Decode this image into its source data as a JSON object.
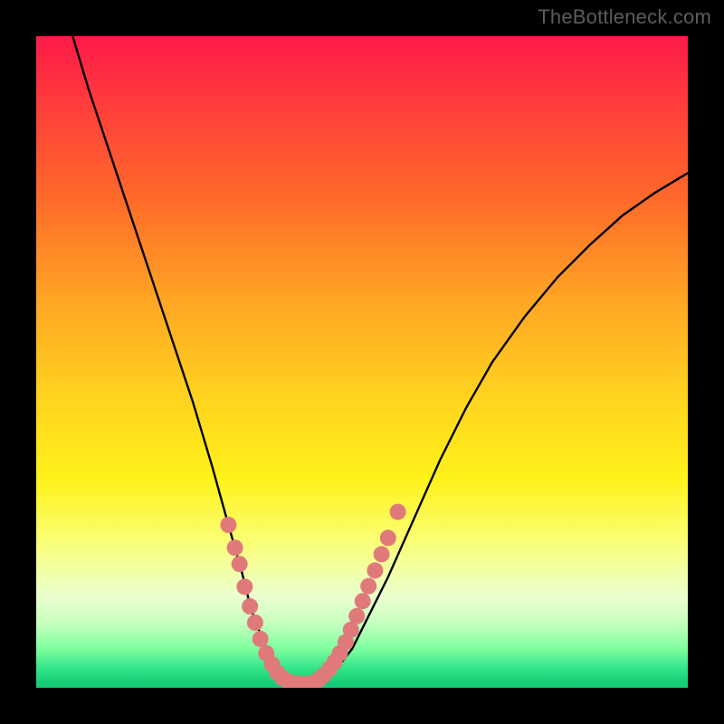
{
  "watermark": "TheBottleneck.com",
  "chart_data": {
    "type": "line",
    "title": "",
    "xlabel": "",
    "ylabel": "",
    "xlim": [
      0,
      100
    ],
    "ylim": [
      0,
      100
    ],
    "series": [
      {
        "name": "curve",
        "x": [
          5,
          8,
          12,
          16,
          20,
          24,
          27,
          29.5,
          31.5,
          33,
          34.5,
          36,
          37.5,
          39,
          40.5,
          42,
          44,
          46,
          48.5,
          51,
          54,
          58,
          62,
          66,
          70,
          75,
          80,
          85,
          90,
          95,
          100
        ],
        "y": [
          102,
          92,
          80,
          68,
          56,
          44,
          34,
          25,
          18,
          12,
          8,
          4.5,
          2.2,
          1,
          0.6,
          0.6,
          1.2,
          2.8,
          6,
          11,
          17,
          26,
          35,
          43,
          50,
          57,
          63,
          68,
          72.5,
          76,
          79
        ]
      }
    ],
    "highlight_points": {
      "name": "dots",
      "color": "#e07a7a",
      "points": [
        [
          29.5,
          25
        ],
        [
          30.5,
          21.5
        ],
        [
          31.2,
          19
        ],
        [
          32.0,
          15.5
        ],
        [
          32.8,
          12.5
        ],
        [
          33.6,
          10
        ],
        [
          34.4,
          7.5
        ],
        [
          35.3,
          5.3
        ],
        [
          36.2,
          3.6
        ],
        [
          37.0,
          2.3
        ],
        [
          37.8,
          1.5
        ],
        [
          38.6,
          1.0
        ],
        [
          39.5,
          0.7
        ],
        [
          40.5,
          0.6
        ],
        [
          41.5,
          0.6
        ],
        [
          42.4,
          0.7
        ],
        [
          43.3,
          1.2
        ],
        [
          44.1,
          1.9
        ],
        [
          45.0,
          2.9
        ],
        [
          45.8,
          4.0
        ],
        [
          46.6,
          5.3
        ],
        [
          47.5,
          7.0
        ],
        [
          48.3,
          8.9
        ],
        [
          49.2,
          11.0
        ],
        [
          50.1,
          13.3
        ],
        [
          51.0,
          15.6
        ],
        [
          52.0,
          18.0
        ],
        [
          53.0,
          20.5
        ],
        [
          54.0,
          23.0
        ],
        [
          55.5,
          27.0
        ]
      ]
    },
    "background_gradient": {
      "top": "#ff1a4a",
      "mid": "#ffd21f",
      "bottom": "#16c875"
    }
  }
}
